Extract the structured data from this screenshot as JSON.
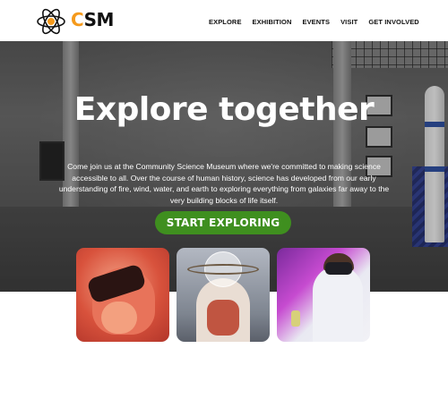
{
  "brand": {
    "name_first": "C",
    "name_rest": "SM",
    "logo_icon": "atom-icon",
    "accent": "#f59a1c"
  },
  "nav": {
    "items": [
      "EXPLORE",
      "EXHIBITION",
      "EVENTS",
      "VISIT",
      "GET INVOLVED"
    ]
  },
  "hero": {
    "title": "Explore together",
    "text": "Come join us at the Community Science Museum where we're committed to making science accessible to all. Over the course of human history, science has developed from our early understanding of fire, wind, water, and earth to exploring everything from galaxies far away to the very building blocks of life itself.",
    "cta_label": "START EXPLORING",
    "cta_color": "#3f8f1f"
  },
  "cards": [
    {
      "image": "child-with-vr-headset"
    },
    {
      "image": "anatomy-model"
    },
    {
      "image": "person-with-vr-headset-in-lab"
    }
  ]
}
